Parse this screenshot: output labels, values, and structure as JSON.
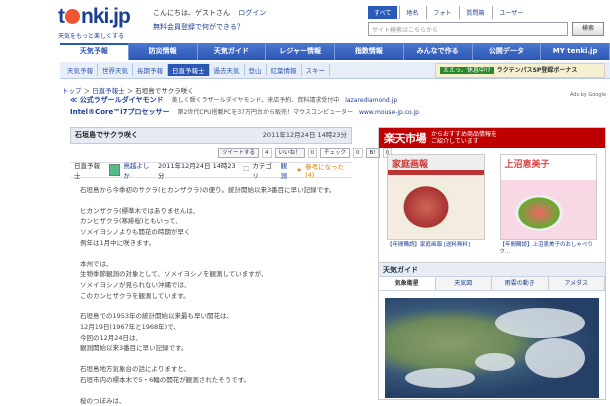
{
  "header": {
    "logo_text": "t  nki.jp",
    "logo_sub": "天気をもっと楽しくする",
    "greeting": "こんにちは、ゲストさん",
    "login": "ログイン",
    "signup": "無料会員登録で何ができる？",
    "search_tabs": [
      "すべて",
      "地名",
      "フォト",
      "質問箱",
      "ユーザー"
    ],
    "search_placeholder": "サイト検索はこちらから",
    "search_button": "検索"
  },
  "nav": {
    "items": [
      "天気予報",
      "防災情報",
      "天気ガイド",
      "レジャー情報",
      "指数情報",
      "みんなで作る",
      "公開データ",
      "MY tenki.jp"
    ]
  },
  "subnav": {
    "items": [
      "天気予報",
      "世界天気",
      "長期予報",
      "日直予報士",
      "過去天気",
      "登山",
      "紅葉情報",
      "スキー"
    ],
    "banner_tag": "ええっ、休息中!?",
    "banner_text": "ラクテンパスSP登録ボーナス"
  },
  "breadcrumb": {
    "top": "トップ",
    "section": "日直予報士",
    "current": "石垣島でサクラ咲く"
  },
  "ads": {
    "ads_by": "Ads by Google",
    "rows": [
      {
        "title": "≪ 公式ラザールダイヤモンド",
        "desc": "美しく輝くラザールダイヤモンド。来店予約、資料請求受付中",
        "url": "lazarediamond.jp"
      },
      {
        "title": "Intel®Core™i7プロセッサー",
        "desc": "第2世代CPU搭載PCを37万円台から販売！マウスコンピューター",
        "url": "www.mouse-jp.co.jp"
      }
    ]
  },
  "article": {
    "title": "石垣島でサクラ咲く",
    "date": "2011年12月24日 14時23分",
    "share": {
      "tweet": "ツイートする",
      "tweet_count": "4",
      "like": "いいね！",
      "like_count": "0",
      "check": "チェック",
      "check_count": "0",
      "hatena": "B!",
      "hatena_count": "0"
    },
    "meta": {
      "role": "日直予報士",
      "author": "鳥越よしか",
      "datetime": "2011年12月24日 14時23分",
      "category_label": "カテゴリ",
      "category": "観測",
      "helpful": "参考になった(4)"
    },
    "paragraphs": [
      [
        "石垣島から今季初のサクラ(ヒカンザクラ)の便り。統計開始以来3番目に早い記録です。"
      ],
      [
        "ヒカンザクラ(標準木ではありませんは、",
        "カンヒザクラ(寒緋桜)ともいって、",
        "ソメイヨシノよりも開花の時期が早く",
        "例年は1月中に咲きます。"
      ],
      [
        "本州では、",
        "生物季節観測の対象として、ソメイヨシノを観測していますが、",
        "ソメイヨシノが見られない沖縄では、",
        "このカンヒザクラを観測しています。"
      ],
      [
        "石垣島での1953年の統計開始以来最も早い開花は、",
        "12月19日(1967年と1968年)で、",
        "今回の12月24日は、",
        "観測開始以来3番目に早い記録です。"
      ],
      [
        "石垣島地方気象台の話によりますと、",
        "石垣市内の標本木で5・6輪の開花が観測されたそうです。"
      ],
      [
        "桜のつぼみは、"
      ]
    ]
  },
  "rakuten": {
    "logo": "楽天市場",
    "sub1": "からおすすめ商品情報を",
    "sub2": "ご紹介しています",
    "books": [
      {
        "cover": "家庭画報",
        "caption": "【年間購読】家庭画報 [送料無料]"
      },
      {
        "cover": "上沼恵美子",
        "caption": "【年間購読】上沼恵美子のおしゃべりク..."
      }
    ],
    "footer": "楽天"
  },
  "weather_guide": {
    "title": "天気ガイド",
    "tabs": [
      "気象衛星",
      "天気図",
      "雨雲の動き",
      "アメダス"
    ]
  }
}
